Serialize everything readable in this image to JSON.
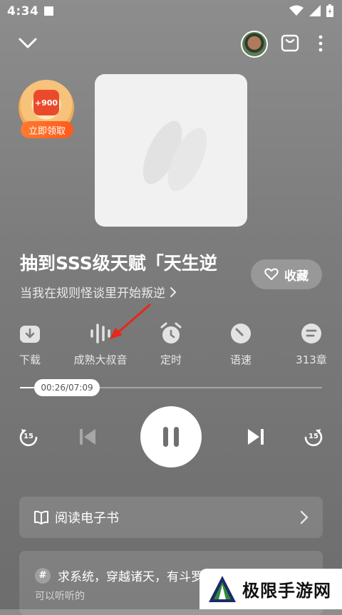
{
  "status_bar": {
    "time": "4:34"
  },
  "reward": {
    "amount": "+900",
    "claim_label": "立即领取"
  },
  "book": {
    "title": "抽到SSS级天赋「天生逆",
    "subtitle": "当我在规则怪谈里开始叛逆",
    "favorite_label": "收藏"
  },
  "tools": [
    {
      "label": "下载",
      "icon": "download-icon"
    },
    {
      "label": "成熟大叔音",
      "icon": "voice-wave-icon"
    },
    {
      "label": "定时",
      "icon": "alarm-clock-icon"
    },
    {
      "label": "语速",
      "icon": "speed-icon"
    },
    {
      "label": "313章",
      "icon": "chapters-icon"
    }
  ],
  "player": {
    "time_display": "00:26/07:09",
    "progress_fraction": 0.06,
    "skip_back": "15",
    "skip_forward": "15"
  },
  "read_card": {
    "label": "阅读电子书"
  },
  "recommend": {
    "title": "求系统，穿越诸天，有斗罗",
    "subtitle": "可以听听的"
  },
  "watermark": {
    "text": "极限手游网"
  }
}
